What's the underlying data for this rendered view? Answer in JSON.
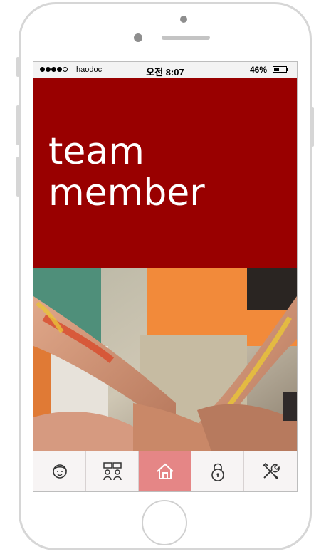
{
  "status_bar": {
    "carrier": "haodoc",
    "time": "오전 8:07",
    "battery_percent": "46%",
    "battery_level": 0.46,
    "signal_bars": 4
  },
  "hero": {
    "title": "team\nmember",
    "background_color": "#990000"
  },
  "photo": {
    "description_icon": "team-hands-photo"
  },
  "tabbar": {
    "active_color": "#e58686",
    "tabs": [
      {
        "icon": "support-agent-icon",
        "active": false
      },
      {
        "icon": "team-meeting-icon",
        "active": false
      },
      {
        "icon": "home-icon",
        "active": true
      },
      {
        "icon": "lock-icon",
        "active": false
      },
      {
        "icon": "tools-icon",
        "active": false
      }
    ]
  }
}
